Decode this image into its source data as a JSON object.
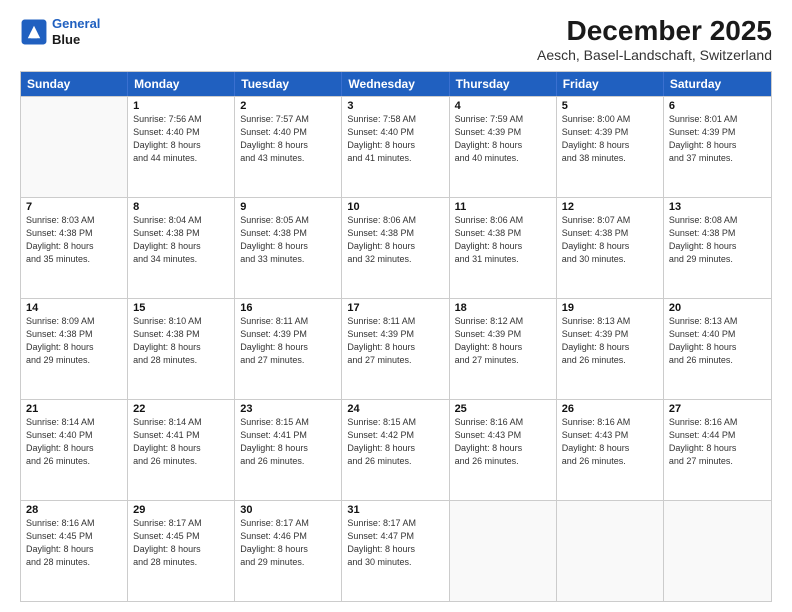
{
  "logo": {
    "line1": "General",
    "line2": "Blue"
  },
  "title": "December 2025",
  "subtitle": "Aesch, Basel-Landschaft, Switzerland",
  "weekdays": [
    "Sunday",
    "Monday",
    "Tuesday",
    "Wednesday",
    "Thursday",
    "Friday",
    "Saturday"
  ],
  "rows": [
    [
      {
        "day": "",
        "info": ""
      },
      {
        "day": "1",
        "info": "Sunrise: 7:56 AM\nSunset: 4:40 PM\nDaylight: 8 hours\nand 44 minutes."
      },
      {
        "day": "2",
        "info": "Sunrise: 7:57 AM\nSunset: 4:40 PM\nDaylight: 8 hours\nand 43 minutes."
      },
      {
        "day": "3",
        "info": "Sunrise: 7:58 AM\nSunset: 4:40 PM\nDaylight: 8 hours\nand 41 minutes."
      },
      {
        "day": "4",
        "info": "Sunrise: 7:59 AM\nSunset: 4:39 PM\nDaylight: 8 hours\nand 40 minutes."
      },
      {
        "day": "5",
        "info": "Sunrise: 8:00 AM\nSunset: 4:39 PM\nDaylight: 8 hours\nand 38 minutes."
      },
      {
        "day": "6",
        "info": "Sunrise: 8:01 AM\nSunset: 4:39 PM\nDaylight: 8 hours\nand 37 minutes."
      }
    ],
    [
      {
        "day": "7",
        "info": "Sunrise: 8:03 AM\nSunset: 4:38 PM\nDaylight: 8 hours\nand 35 minutes."
      },
      {
        "day": "8",
        "info": "Sunrise: 8:04 AM\nSunset: 4:38 PM\nDaylight: 8 hours\nand 34 minutes."
      },
      {
        "day": "9",
        "info": "Sunrise: 8:05 AM\nSunset: 4:38 PM\nDaylight: 8 hours\nand 33 minutes."
      },
      {
        "day": "10",
        "info": "Sunrise: 8:06 AM\nSunset: 4:38 PM\nDaylight: 8 hours\nand 32 minutes."
      },
      {
        "day": "11",
        "info": "Sunrise: 8:06 AM\nSunset: 4:38 PM\nDaylight: 8 hours\nand 31 minutes."
      },
      {
        "day": "12",
        "info": "Sunrise: 8:07 AM\nSunset: 4:38 PM\nDaylight: 8 hours\nand 30 minutes."
      },
      {
        "day": "13",
        "info": "Sunrise: 8:08 AM\nSunset: 4:38 PM\nDaylight: 8 hours\nand 29 minutes."
      }
    ],
    [
      {
        "day": "14",
        "info": "Sunrise: 8:09 AM\nSunset: 4:38 PM\nDaylight: 8 hours\nand 29 minutes."
      },
      {
        "day": "15",
        "info": "Sunrise: 8:10 AM\nSunset: 4:38 PM\nDaylight: 8 hours\nand 28 minutes."
      },
      {
        "day": "16",
        "info": "Sunrise: 8:11 AM\nSunset: 4:39 PM\nDaylight: 8 hours\nand 27 minutes."
      },
      {
        "day": "17",
        "info": "Sunrise: 8:11 AM\nSunset: 4:39 PM\nDaylight: 8 hours\nand 27 minutes."
      },
      {
        "day": "18",
        "info": "Sunrise: 8:12 AM\nSunset: 4:39 PM\nDaylight: 8 hours\nand 27 minutes."
      },
      {
        "day": "19",
        "info": "Sunrise: 8:13 AM\nSunset: 4:39 PM\nDaylight: 8 hours\nand 26 minutes."
      },
      {
        "day": "20",
        "info": "Sunrise: 8:13 AM\nSunset: 4:40 PM\nDaylight: 8 hours\nand 26 minutes."
      }
    ],
    [
      {
        "day": "21",
        "info": "Sunrise: 8:14 AM\nSunset: 4:40 PM\nDaylight: 8 hours\nand 26 minutes."
      },
      {
        "day": "22",
        "info": "Sunrise: 8:14 AM\nSunset: 4:41 PM\nDaylight: 8 hours\nand 26 minutes."
      },
      {
        "day": "23",
        "info": "Sunrise: 8:15 AM\nSunset: 4:41 PM\nDaylight: 8 hours\nand 26 minutes."
      },
      {
        "day": "24",
        "info": "Sunrise: 8:15 AM\nSunset: 4:42 PM\nDaylight: 8 hours\nand 26 minutes."
      },
      {
        "day": "25",
        "info": "Sunrise: 8:16 AM\nSunset: 4:43 PM\nDaylight: 8 hours\nand 26 minutes."
      },
      {
        "day": "26",
        "info": "Sunrise: 8:16 AM\nSunset: 4:43 PM\nDaylight: 8 hours\nand 26 minutes."
      },
      {
        "day": "27",
        "info": "Sunrise: 8:16 AM\nSunset: 4:44 PM\nDaylight: 8 hours\nand 27 minutes."
      }
    ],
    [
      {
        "day": "28",
        "info": "Sunrise: 8:16 AM\nSunset: 4:45 PM\nDaylight: 8 hours\nand 28 minutes."
      },
      {
        "day": "29",
        "info": "Sunrise: 8:17 AM\nSunset: 4:45 PM\nDaylight: 8 hours\nand 28 minutes."
      },
      {
        "day": "30",
        "info": "Sunrise: 8:17 AM\nSunset: 4:46 PM\nDaylight: 8 hours\nand 29 minutes."
      },
      {
        "day": "31",
        "info": "Sunrise: 8:17 AM\nSunset: 4:47 PM\nDaylight: 8 hours\nand 30 minutes."
      },
      {
        "day": "",
        "info": ""
      },
      {
        "day": "",
        "info": ""
      },
      {
        "day": "",
        "info": ""
      }
    ]
  ]
}
